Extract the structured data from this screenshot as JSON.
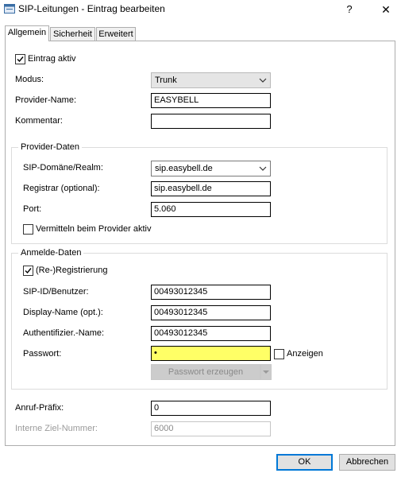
{
  "window": {
    "title": "SIP-Leitungen - Eintrag bearbeiten",
    "help": "?",
    "close": "✕"
  },
  "tabs": [
    {
      "label": "Allgemein",
      "active": true
    },
    {
      "label": "Sicherheit",
      "active": false
    },
    {
      "label": "Erweitert",
      "active": false
    }
  ],
  "general": {
    "entry_active_label": "Eintrag aktiv",
    "entry_active_checked": true,
    "mode_label": "Modus:",
    "mode_value": "Trunk",
    "provider_name_label": "Provider-Name:",
    "provider_name_value": "EASYBELL",
    "comment_label": "Kommentar:",
    "comment_value": ""
  },
  "provider_data": {
    "title": "Provider-Daten",
    "domain_label": "SIP-Domäne/Realm:",
    "domain_value": "sip.easybell.de",
    "registrar_label": "Registrar (optional):",
    "registrar_value": "sip.easybell.de",
    "port_label": "Port:",
    "port_value": "5.060",
    "forward_label": "Vermitteln beim Provider aktiv",
    "forward_checked": false
  },
  "login_data": {
    "title": "Anmelde-Daten",
    "registration_label": "(Re-)Registrierung",
    "registration_checked": true,
    "sip_id_label": "SIP-ID/Benutzer:",
    "sip_id_value": "00493012345",
    "display_name_label": "Display-Name (opt.):",
    "display_name_value": "00493012345",
    "auth_name_label": "Authentifizier.-Name:",
    "auth_name_value": "00493012345",
    "password_label": "Passwort:",
    "password_value": "•",
    "show_label": "Anzeigen",
    "show_checked": false,
    "generate_label": "Passwort erzeugen"
  },
  "bottom": {
    "call_prefix_label": "Anruf-Präfix:",
    "call_prefix_value": "0",
    "internal_number_label": "Interne Ziel-Nummer:",
    "internal_number_value": "6000"
  },
  "buttons": {
    "ok": "OK",
    "cancel": "Abbrechen"
  },
  "colors": {
    "password_highlight": "#ffff66",
    "default_button_border": "#0078d7"
  }
}
